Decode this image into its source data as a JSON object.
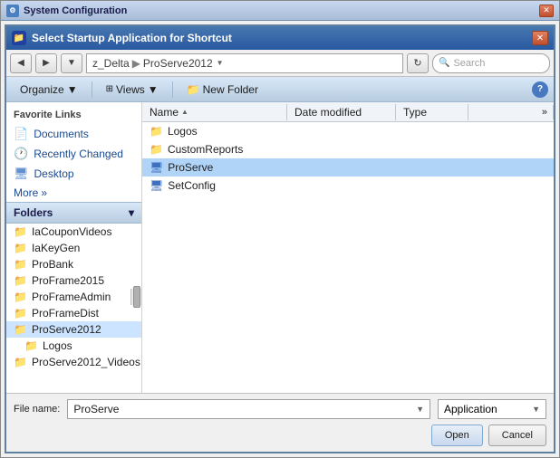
{
  "outerWindow": {
    "title": "System Configuration"
  },
  "innerWindow": {
    "title": "Select Startup Application for Shortcut"
  },
  "addressBar": {
    "back_btn": "◀",
    "forward_btn": "▶",
    "dropdown_btn": "▼",
    "path": {
      "part1": "z_Delta",
      "part2": "ProServe2012"
    },
    "refresh_btn": "↻",
    "search_placeholder": "Search"
  },
  "toolbar": {
    "organize_label": "Organize",
    "views_label": "Views",
    "new_folder_label": "New Folder",
    "organize_arrow": "▼",
    "views_arrow": "▼"
  },
  "leftPanel": {
    "favorites_title": "Favorite Links",
    "items": [
      {
        "icon": "📄",
        "label": "Documents",
        "type": "docs"
      },
      {
        "icon": "🕐",
        "label": "Recently Changed",
        "type": "recent"
      },
      {
        "icon": "🖥",
        "label": "Desktop",
        "type": "desktop"
      }
    ],
    "more_label": "More",
    "more_icon": "»",
    "folders_title": "Folders",
    "folders_arrow": "▾",
    "folder_items": [
      {
        "label": "IaCouponVideos",
        "selected": false
      },
      {
        "label": "IaKeyGen",
        "selected": false
      },
      {
        "label": "ProBank",
        "selected": false
      },
      {
        "label": "ProFrame2015",
        "selected": false
      },
      {
        "label": "ProFrameAdmin",
        "selected": false
      },
      {
        "label": "ProFrameDist",
        "selected": false
      },
      {
        "label": "ProServe2012",
        "selected": true
      },
      {
        "label": "Logos",
        "selected": false,
        "indent": true
      },
      {
        "label": "ProServe2012_Videos",
        "selected": false
      }
    ]
  },
  "rightPanel": {
    "columns": {
      "name": "Name",
      "date_modified": "Date modified",
      "type": "Type"
    },
    "files": [
      {
        "name": "Logos",
        "type": "folder",
        "date": "",
        "filetype": ""
      },
      {
        "name": "CustomReports",
        "type": "folder",
        "date": "",
        "filetype": ""
      },
      {
        "name": "ProServe",
        "type": "exe",
        "date": "",
        "filetype": "",
        "selected": true
      },
      {
        "name": "SetConfig",
        "type": "exe",
        "date": "",
        "filetype": ""
      }
    ]
  },
  "bottomBar": {
    "filename_label": "File name:",
    "filename_value": "ProServe",
    "filetype_value": "Application",
    "open_btn": "Open",
    "cancel_btn": "Cancel"
  }
}
